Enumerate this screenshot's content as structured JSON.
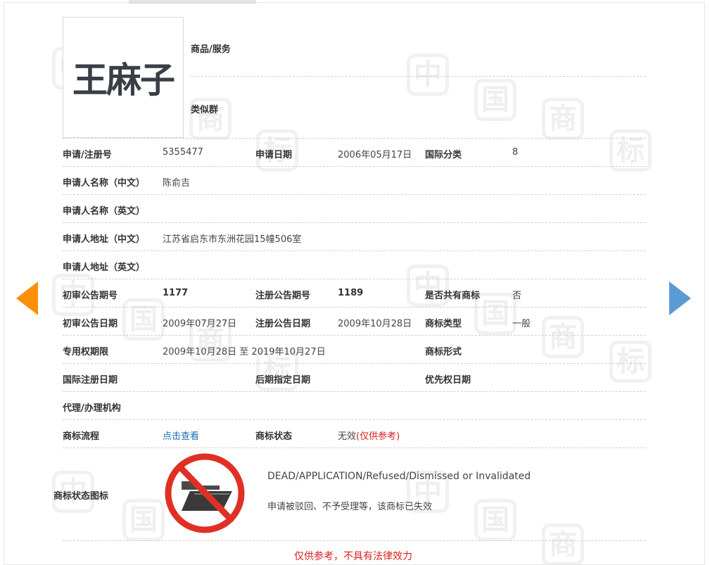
{
  "mark": {
    "logo_text": "王麻子",
    "goods_label": "商品/服务",
    "similar_label": "类似群"
  },
  "fields": {
    "reg_no_label": "申请/注册号",
    "reg_no": "5355477",
    "app_date_label": "申请日期",
    "app_date": "2006年05月17日",
    "intl_class_label": "国际分类",
    "intl_class": "8",
    "applicant_cn_label": "申请人名称（中文）",
    "applicant_cn": "陈俞吉",
    "applicant_en_label": "申请人名称（英文）",
    "address_cn_label": "申请人地址（中文）",
    "address_cn": "江苏省启东市东洲花园15幢506室",
    "address_en_label": "申请人地址（英文）",
    "prelim_no_label": "初审公告期号",
    "prelim_no": "1177",
    "reg_pub_no_label": "注册公告期号",
    "reg_pub_no": "1189",
    "shared_label": "是否共有商标",
    "shared": "否",
    "prelim_date_label": "初审公告日期",
    "prelim_date": "2009年07月27日",
    "reg_pub_date_label": "注册公告日期",
    "reg_pub_date": "2009年10月28日",
    "mark_type_label": "商标类型",
    "mark_type": "一般",
    "term_label": "专用权期限",
    "term": "2009年10月28日 至 2019年10月27日",
    "mark_form_label": "商标形式",
    "intl_reg_date_label": "国际注册日期",
    "later_designation_label": "后期指定日期",
    "priority_date_label": "优先权日期",
    "agent_label": "代理/办理机构",
    "process_label": "商标流程",
    "process_link": "点击查看",
    "status_label": "商标状态",
    "status_value": "无效",
    "status_note": "(仅供参考)"
  },
  "status_icon": {
    "label": "商标状态图标",
    "english": "DEAD/APPLICATION/Refused/Dismissed or Invalidated",
    "chinese": "申请被驳回、不予受理等，该商标已失效"
  },
  "footer": {
    "disclaimer": "仅供参考，不具有法律效力"
  },
  "watermark": {
    "chars": [
      "中",
      "国",
      "商",
      "标"
    ]
  },
  "colors": {
    "prev_arrow": "#ff8f0b",
    "next_arrow": "#5b9bd5",
    "link": "#1a6fb0",
    "alert": "#d8201f"
  },
  "icons": {
    "prev": "left-arrow-icon",
    "next": "right-arrow-icon",
    "status": "no-folder-icon"
  }
}
